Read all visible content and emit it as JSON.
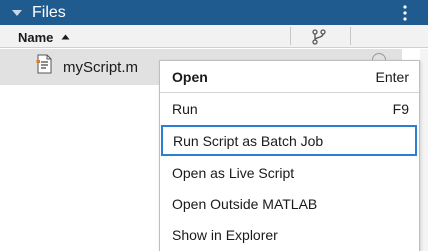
{
  "panel": {
    "title": "Files",
    "collapse_icon": "triangle-down-icon",
    "menu_icon": "vertical-ellipsis-icon",
    "title_bar_color": "#1f5b8f"
  },
  "columns": {
    "name_label": "Name",
    "sort_icon": "sort-ascending-icon",
    "git_icon": "git-branch-icon"
  },
  "files": [
    {
      "name": "myScript.m",
      "icon": "matlab-script-icon",
      "selected": true
    }
  ],
  "context_menu": {
    "focus_color": "#2a7fd4",
    "items": [
      {
        "label": "Open",
        "shortcut": "Enter",
        "bold": true
      },
      {
        "label": "Run",
        "shortcut": "F9"
      },
      {
        "label": "Run Script as Batch Job",
        "focused": true
      },
      {
        "label": "Open as Live Script"
      },
      {
        "label": "Open Outside MATLAB"
      },
      {
        "label": "Show in Explorer"
      }
    ]
  }
}
